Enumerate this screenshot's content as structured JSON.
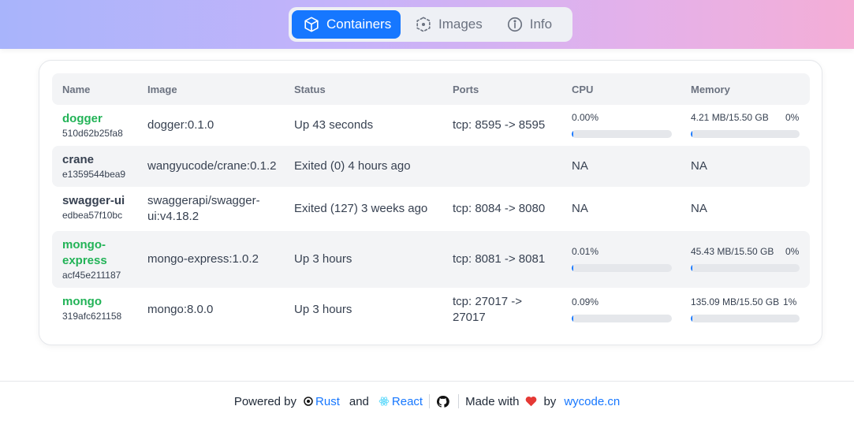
{
  "nav": {
    "tabs": [
      {
        "label": "Containers",
        "icon": "cube-icon",
        "active": true
      },
      {
        "label": "Images",
        "icon": "dashed-box-icon",
        "active": false
      },
      {
        "label": "Info",
        "icon": "info-circle-icon",
        "active": false
      }
    ]
  },
  "table": {
    "headers": {
      "name": "Name",
      "image": "Image",
      "status": "Status",
      "ports": "Ports",
      "cpu": "CPU",
      "memory": "Memory"
    },
    "rows": [
      {
        "name": "dogger",
        "id": "510d62b25fa8",
        "image": "dogger:0.1.0",
        "status": "Up 43 seconds",
        "ports": "tcp: 8595 -> 8595",
        "cpu": "0.00%",
        "cpu_fraction": 0.0,
        "memory": "4.21 MB/15.50 GB",
        "memory_percent": "0%",
        "memory_fraction": 0.0,
        "running": true
      },
      {
        "name": "crane",
        "id": "e1359544bea9",
        "image": "wangyucode/crane:0.1.2",
        "status": "Exited (0) 4 hours ago",
        "ports": "",
        "cpu": "NA",
        "memory": "NA",
        "running": false
      },
      {
        "name": "swagger-ui",
        "id": "edbea57f10bc",
        "image": "swaggerapi/swagger-ui:v4.18.2",
        "status": "Exited (127) 3 weeks ago",
        "ports": "tcp: 8084 -> 8080",
        "cpu": "NA",
        "memory": "NA",
        "running": false
      },
      {
        "name": "mongo-express",
        "id": "acf45e211187",
        "image": "mongo-express:1.0.2",
        "status": "Up 3 hours",
        "ports": "tcp: 8081 -> 8081",
        "cpu": "0.01%",
        "cpu_fraction": 0.0001,
        "memory": "45.43 MB/15.50 GB",
        "memory_percent": "0%",
        "memory_fraction": 0.003,
        "running": true
      },
      {
        "name": "mongo",
        "id": "319afc621158",
        "image": "mongo:8.0.0",
        "status": "Up 3 hours",
        "ports": "tcp: 27017 -> 27017",
        "cpu": "0.09%",
        "cpu_fraction": 0.0009,
        "memory": "135.09 MB/15.50 GB",
        "memory_percent": "1%",
        "memory_fraction": 0.01,
        "running": true
      }
    ]
  },
  "footer": {
    "powered_by": "Powered by",
    "rust": "Rust",
    "and": "and",
    "react": "React",
    "made_with": "Made with",
    "by": "by",
    "site": "wycode.cn"
  },
  "colors": {
    "accent": "#1677ff",
    "running": "#22b357",
    "heart": "#e53935"
  }
}
